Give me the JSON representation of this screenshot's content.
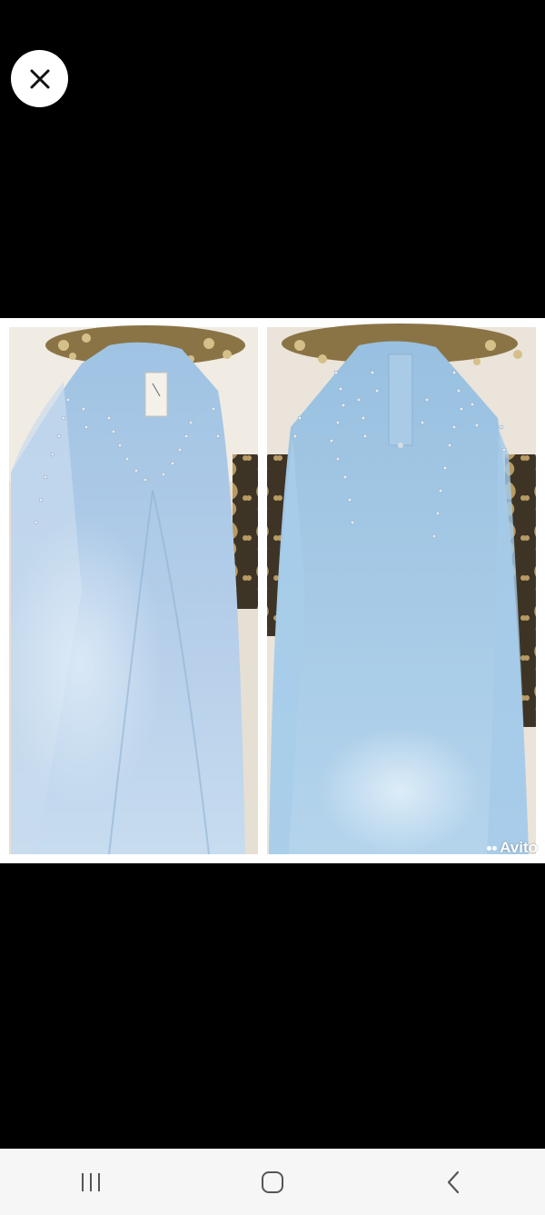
{
  "viewer": {
    "close_icon": "close-icon",
    "watermark_text": "Avito"
  },
  "navbar": {
    "recents_icon": "recents-icon",
    "home_icon": "home-icon",
    "back_icon": "back-icon"
  },
  "colors": {
    "background": "#000000",
    "dress": "#a9cbe6",
    "navbar": "#f6f6f6"
  }
}
